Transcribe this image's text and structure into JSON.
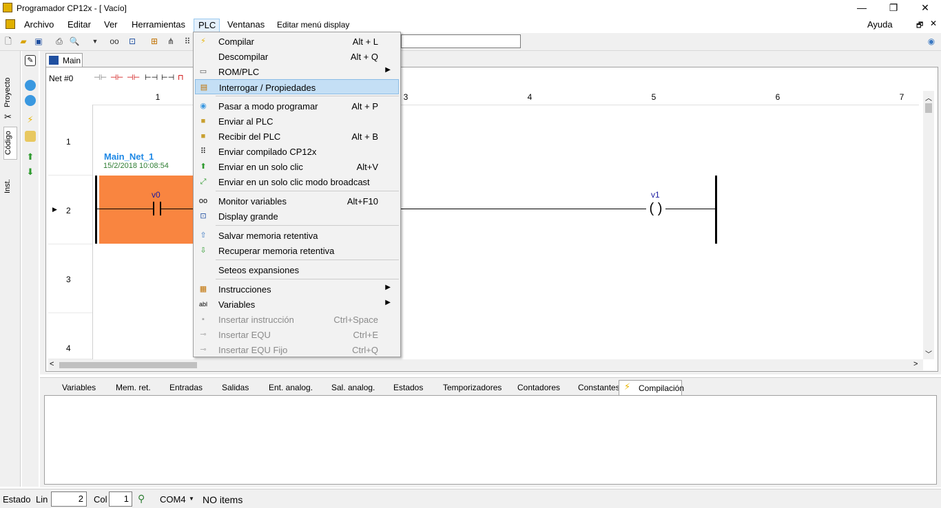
{
  "window": {
    "title": "Programador CP12x - [ Vacío]",
    "controls": {
      "minimize": "—",
      "maximize": "❐",
      "close": "✕"
    }
  },
  "menubar": {
    "items": [
      "Archivo",
      "Editar",
      "Ver",
      "Herramientas",
      "PLC",
      "Ventanas",
      "Editar menú display"
    ],
    "help": "Ayuda"
  },
  "left_tabs": [
    "Proyecto",
    "Código",
    "Inst."
  ],
  "doc": {
    "tab": "Main",
    "net_label": "Net #0",
    "columns": [
      "1",
      "3",
      "4",
      "5",
      "6",
      "7"
    ],
    "rows": [
      "1",
      "2",
      "3",
      "4"
    ],
    "network_name": "Main_Net_1",
    "network_date": "15/2/2018 10:08:54",
    "contact_var": "v0",
    "coil_var": "v1",
    "colors": {
      "contact_bg": "#f98540",
      "netname": "#1e88e5",
      "netdate": "#2e7d32"
    }
  },
  "plc_menu": {
    "items": [
      {
        "label": "Compilar",
        "shortcut": "Alt + L",
        "icon": "lightning-icon"
      },
      {
        "label": "Descompilar",
        "shortcut": "Alt + Q",
        "icon": "none"
      },
      {
        "label": "ROM/PLC",
        "shortcut": "",
        "icon": "rom-icon",
        "submenu": true
      },
      {
        "label": "Interrogar / Propiedades",
        "shortcut": "",
        "icon": "interrogate-icon",
        "highlighted": true
      },
      {
        "label": "Pasar a modo programar",
        "shortcut": "Alt + P",
        "icon": "stop-icon"
      },
      {
        "label": "Enviar al PLC",
        "shortcut": "",
        "icon": "send-icon"
      },
      {
        "label": "Recibir del PLC",
        "shortcut": "Alt + B",
        "icon": "receive-icon"
      },
      {
        "label": "Enviar compilado CP12x",
        "shortcut": "",
        "icon": "send-compiled-icon"
      },
      {
        "label": "Enviar en un solo clic",
        "shortcut": "Alt+V",
        "icon": "upload-icon"
      },
      {
        "label": "Enviar en un solo clic modo broadcast",
        "shortcut": "",
        "icon": "broadcast-icon"
      },
      {
        "label": "Monitor variables",
        "shortcut": "Alt+F10",
        "icon": "glasses-icon"
      },
      {
        "label": "Display grande",
        "shortcut": "",
        "icon": "display-icon"
      },
      {
        "label": "Salvar memoria retentiva",
        "shortcut": "",
        "icon": "save-mem-icon"
      },
      {
        "label": "Recuperar memoria retentiva",
        "shortcut": "",
        "icon": "restore-mem-icon"
      },
      {
        "label": "Seteos expansiones",
        "shortcut": "",
        "icon": "none"
      },
      {
        "label": "Instrucciones",
        "shortcut": "",
        "icon": "instructions-icon",
        "submenu": true
      },
      {
        "label": "Variables",
        "shortcut": "",
        "icon": "abl-icon",
        "submenu": true
      },
      {
        "label": "Insertar instrucción",
        "shortcut": "Ctrl+Space",
        "icon": "insert-icon",
        "disabled": true
      },
      {
        "label": "Insertar EQU",
        "shortcut": "Ctrl+E",
        "icon": "equ-icon",
        "disabled": true
      },
      {
        "label": "Insertar EQU Fijo",
        "shortcut": "Ctrl+Q",
        "icon": "equ-fixed-icon",
        "disabled": true
      }
    ]
  },
  "bottom_tabs": [
    "Variables",
    "Mem. ret.",
    "Entradas",
    "Salidas",
    "Ent. analog.",
    "Sal. analog.",
    "Estados",
    "Temporizadores",
    "Contadores",
    "Constantes",
    "Compilación"
  ],
  "status": {
    "estado": "Estado",
    "lin_label": "Lin",
    "lin_value": "2",
    "col_label": "Col",
    "col_value": "1",
    "port": "COM4",
    "message": "NO items"
  }
}
